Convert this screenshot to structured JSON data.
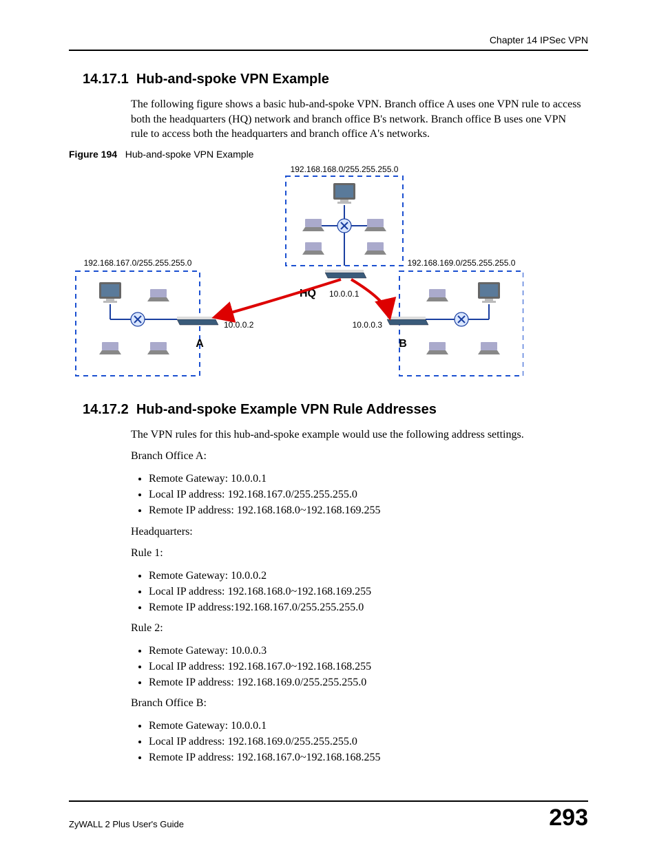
{
  "header": {
    "chapter": "Chapter 14 IPSec VPN"
  },
  "s1": {
    "num": "14.17.1",
    "title": "Hub-and-spoke VPN Example",
    "para": "The following figure shows a basic hub-and-spoke VPN. Branch office A uses one VPN rule to access both the headquarters (HQ) network and branch office B's network. Branch office B uses one VPN rule to access both the headquarters and branch office A's networks.",
    "fig_num": "Figure 194",
    "fig_title": "Hub-and-spoke VPN Example"
  },
  "fig": {
    "net_hq": "192.168.168.0/255.255.255.0",
    "net_a": "192.168.167.0/255.255.255.0",
    "net_b": "192.168.169.0/255.255.255.0",
    "hq_label": "HQ",
    "hq_ip": "10.0.0.1",
    "a_label": "A",
    "a_ip": "10.0.0.2",
    "b_label": "B",
    "b_ip": "10.0.0.3"
  },
  "s2": {
    "num": "14.17.2",
    "title": "Hub-and-spoke Example VPN Rule Addresses",
    "intro": "The VPN rules for this hub-and-spoke example would use the following address settings.",
    "ba_h": "Branch Office A:",
    "ba": {
      "l1": "Remote Gateway: 10.0.0.1",
      "l2": "Local IP address: 192.168.167.0/255.255.255.0",
      "l3": "Remote IP address: 192.168.168.0~192.168.169.255"
    },
    "hq_h": "Headquarters:",
    "r1_h": "Rule 1:",
    "r1": {
      "l1": "Remote Gateway: 10.0.0.2",
      "l2": "Local IP address: 192.168.168.0~192.168.169.255",
      "l3": "Remote IP address:192.168.167.0/255.255.255.0"
    },
    "r2_h": "Rule 2:",
    "r2": {
      "l1": "Remote Gateway: 10.0.0.3",
      "l2": "Local IP address: 192.168.167.0~192.168.168.255",
      "l3": "Remote IP address: 192.168.169.0/255.255.255.0"
    },
    "bb_h": "Branch Office B:",
    "bb": {
      "l1": "Remote Gateway: 10.0.0.1",
      "l2": "Local IP address: 192.168.169.0/255.255.255.0",
      "l3": "Remote IP address: 192.168.167.0~192.168.168.255"
    }
  },
  "footer": {
    "guide": "ZyWALL 2 Plus User's Guide",
    "page": "293"
  }
}
